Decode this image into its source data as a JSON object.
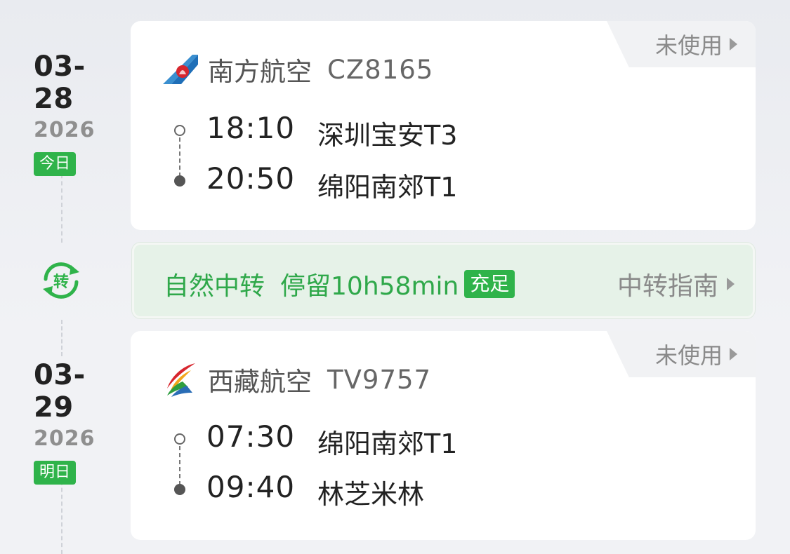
{
  "colors": {
    "accent_green": "#2fb34a",
    "transfer_bg": "#e6f2e8",
    "text_primary": "#222222",
    "text_secondary": "#8a8a8a"
  },
  "flights": [
    {
      "date_md": "03-28",
      "year": "2026",
      "day_label": "今日",
      "status": "未使用",
      "airline": "南方航空",
      "airline_logo": "china-southern-logo",
      "flight_no": "CZ8165",
      "departure": {
        "time": "18:10",
        "airport": "深圳宝安T3"
      },
      "arrival": {
        "time": "20:50",
        "airport": "绵阳南郊T1"
      }
    },
    {
      "date_md": "03-29",
      "year": "2026",
      "day_label": "明日",
      "status": "未使用",
      "airline": "西藏航空",
      "airline_logo": "tibet-airlines-logo",
      "flight_no": "TV9757",
      "departure": {
        "time": "07:30",
        "airport": "绵阳南郊T1"
      },
      "arrival": {
        "time": "09:40",
        "airport": "林芝米林"
      }
    }
  ],
  "transfer": {
    "icon_label": "转",
    "type": "自然中转",
    "layover": "停留10h58min",
    "badge": "充足",
    "guide_label": "中转指南"
  }
}
